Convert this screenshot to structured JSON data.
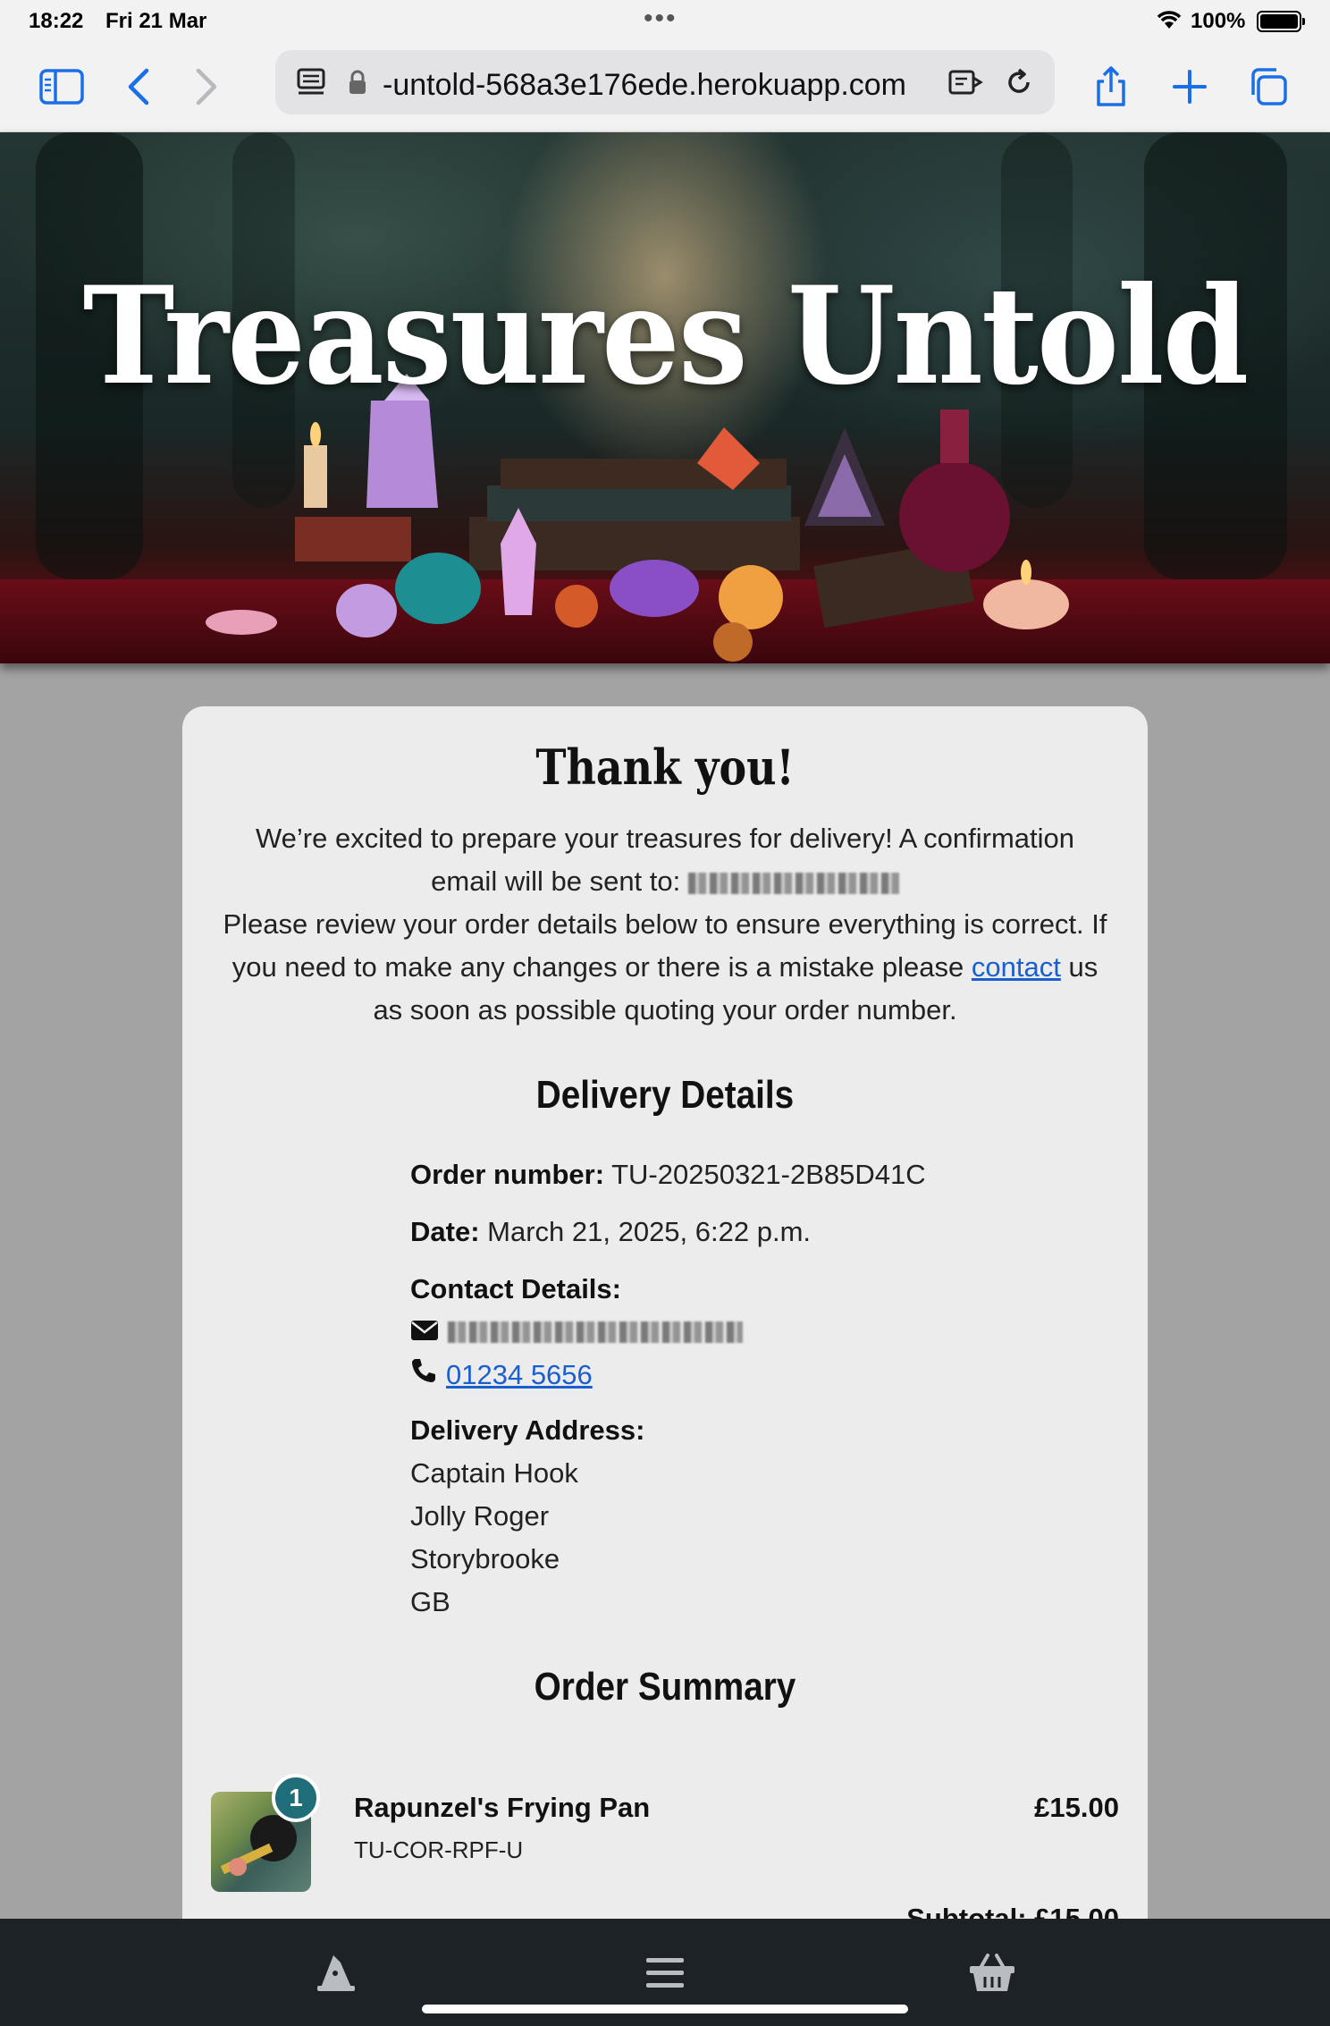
{
  "status": {
    "time": "18:22",
    "date": "Fri 21 Mar",
    "battery": "100%"
  },
  "browser": {
    "url": "-untold-568a3e176ede.herokuapp.com"
  },
  "hero": {
    "title": "Treasures Untold"
  },
  "card": {
    "heading": "Thank you!",
    "intro_1": "We’re excited to prepare your treasures for delivery! A confirmation",
    "intro_2_prefix": "email will be sent to:",
    "intro_3": "Please review your order details below to ensure everything is correct. If",
    "intro_4_prefix": "you need to make any changes or there is a mistake please",
    "contact_link": "contact",
    "intro_4_suffix": "us",
    "intro_5": "as soon as possible quoting your order number."
  },
  "delivery": {
    "heading": "Delivery Details",
    "order_number_label": "Order number:",
    "order_number": "TU-20250321-2B85D41C",
    "date_label": "Date:",
    "date": "March 21, 2025, 6:22 p.m.",
    "contact_label": "Contact Details:",
    "phone": "01234 5656",
    "address_label": "Delivery Address:",
    "address": [
      "Captain Hook",
      "Jolly Roger",
      "Storybrooke",
      "GB"
    ]
  },
  "summary": {
    "heading": "Order Summary",
    "items": [
      {
        "qty": "1",
        "name": "Rapunzel's Frying Pan",
        "sku": "TU-COR-RPF-U",
        "price": "£15.00"
      }
    ],
    "subtotal_peek": "Subtotal: £15.00"
  },
  "nav": {
    "icons": [
      "wizard-hat-icon",
      "hamburger-menu-icon",
      "basket-icon"
    ]
  }
}
